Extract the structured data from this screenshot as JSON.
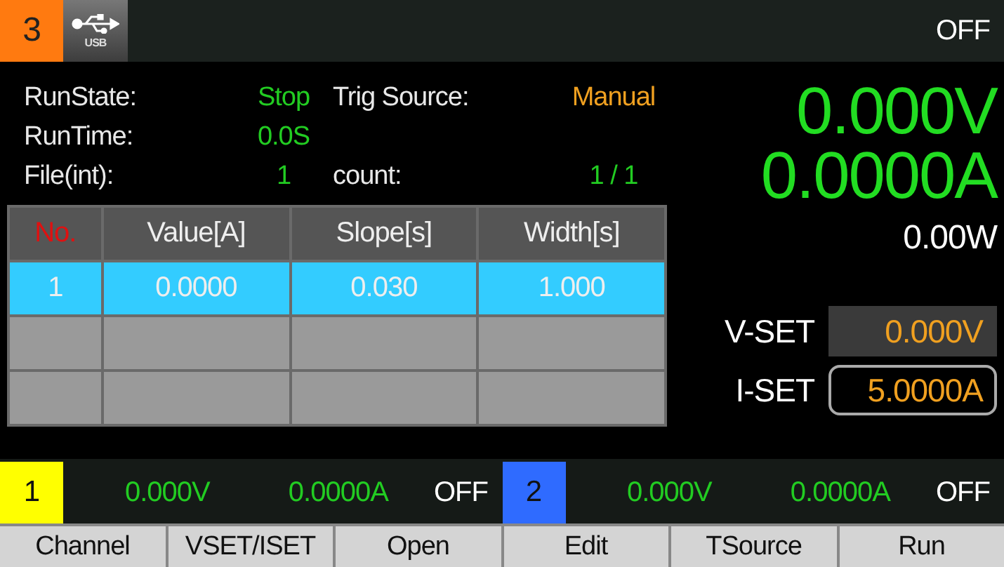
{
  "top_bar": {
    "channel": "3",
    "interface": "USB",
    "output_state": "OFF"
  },
  "status": [
    {
      "label": "RunState:",
      "value": "Stop",
      "kind": "green"
    },
    {
      "label": "Trig Source:",
      "value": "Manual",
      "kind": "orange"
    },
    {
      "label": "RunTime:",
      "value": "0.0S",
      "kind": "green"
    },
    {
      "label": "File(int):",
      "value": "1",
      "kind": "green"
    },
    {
      "label": "count:",
      "value": "1 / 1",
      "kind": "green"
    }
  ],
  "table": {
    "columns": [
      "No.",
      "Value[A]",
      "Slope[s]",
      "Width[s]"
    ],
    "rows": [
      {
        "cells": [
          "1",
          "0.0000",
          "0.030",
          "1.000"
        ],
        "selected": true
      },
      {
        "cells": [],
        "selected": false
      },
      {
        "cells": [],
        "selected": false
      }
    ]
  },
  "readout": {
    "voltage": "0.000V",
    "current": "0.0000A",
    "power": "0.00W"
  },
  "setpoints": [
    {
      "label": "V-SET",
      "value": "0.000V",
      "selected": false
    },
    {
      "label": "I-SET",
      "value": "5.0000A",
      "selected": true
    }
  ],
  "channels": [
    {
      "number": "1",
      "color": "#ffff00",
      "voltage": "0.000V",
      "current": "0.0000A",
      "state": "OFF"
    },
    {
      "number": "2",
      "color": "#2f6bff",
      "voltage": "0.000V",
      "current": "0.0000A",
      "state": "OFF"
    }
  ],
  "softkeys": [
    "Channel",
    "VSET/ISET",
    "Open",
    "Edit",
    "TSource",
    "Run"
  ]
}
